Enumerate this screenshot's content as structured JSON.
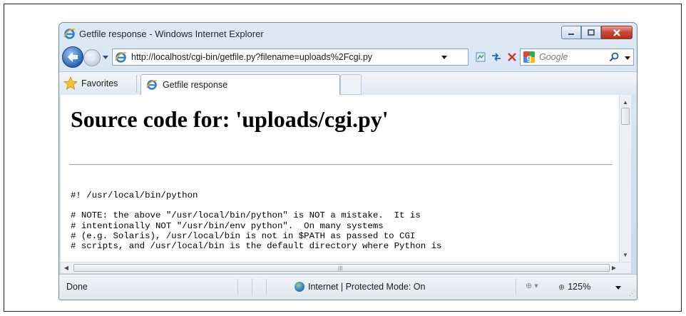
{
  "window": {
    "title": "Getfile response - Windows Internet Explorer"
  },
  "address_bar": {
    "url": "http://localhost/cgi-bin/getfile.py?filename=uploads%2Fcgi.py"
  },
  "search": {
    "placeholder": "Google"
  },
  "favorites": {
    "label": "Favorites"
  },
  "tabs": [
    {
      "label": "Getfile response"
    }
  ],
  "page": {
    "heading": "Source code for: 'uploads/cgi.py'",
    "code_lines": [
      "#! /usr/local/bin/python",
      "",
      "# NOTE: the above \"/usr/local/bin/python\" is NOT a mistake.  It is",
      "# intentionally NOT \"/usr/bin/env python\".  On many systems",
      "# (e.g. Solaris), /usr/local/bin is not in $PATH as passed to CGI",
      "# scripts, and /usr/local/bin is the default directory where Python is"
    ]
  },
  "statusbar": {
    "status": "Done",
    "zone": "Internet | Protected Mode: On",
    "zoom": "125%"
  },
  "colors": {
    "chrome": "#c7d9ec",
    "close_button": "#c64632"
  }
}
